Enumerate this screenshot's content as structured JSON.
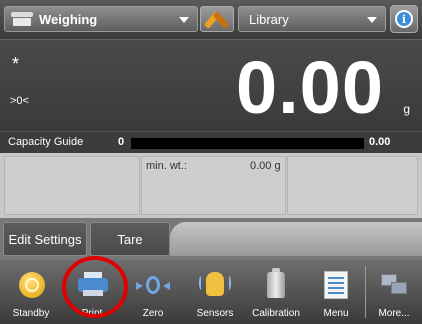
{
  "header": {
    "application": "Weighing",
    "library": "Library",
    "icons": {
      "application": "scale-icon",
      "tools": "wrench-icon",
      "info": "info-icon"
    }
  },
  "display": {
    "stable_indicator": "*",
    "center_of_zero": ">0<",
    "weight": "0.00",
    "unit": "g"
  },
  "capacity_guide": {
    "label": "Capacity Guide",
    "min": "0",
    "max": "0.00"
  },
  "info_panel": {
    "min_wt_label": "min. wt.:",
    "min_wt_value": "0.00 g"
  },
  "actions": {
    "edit_settings": "Edit Settings",
    "tare": "Tare"
  },
  "toolbar": {
    "items": [
      {
        "label": "Standby",
        "icon": "standby-icon"
      },
      {
        "label": "Print",
        "icon": "printer-icon"
      },
      {
        "label": "Zero",
        "icon": "zero-icon"
      },
      {
        "label": "Sensors",
        "icon": "sensors-icon"
      },
      {
        "label": "Calibration",
        "icon": "calibration-weight-icon"
      },
      {
        "label": "Menu",
        "icon": "menu-icon"
      },
      {
        "label": "More...",
        "icon": "more-icon"
      }
    ]
  },
  "colors": {
    "highlight": "#e00000",
    "accent_blue": "#4a8bd0"
  }
}
